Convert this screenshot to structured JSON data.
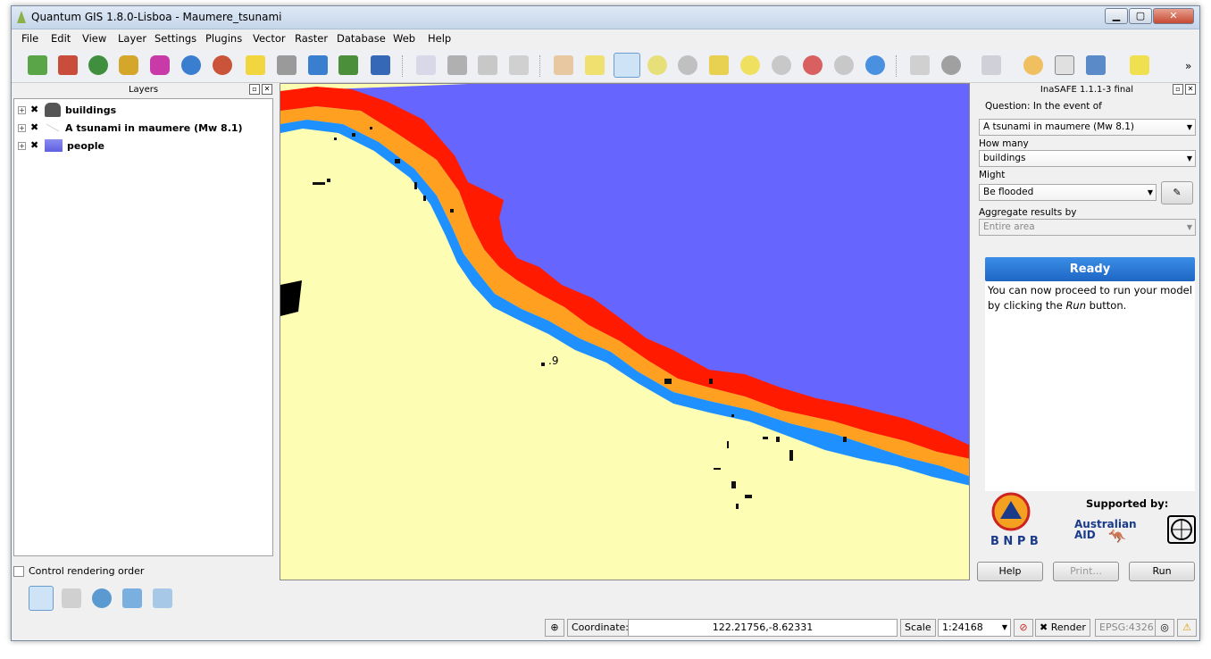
{
  "window": {
    "title": "Quantum GIS 1.8.0-Lisboa - Maumere_tsunami"
  },
  "menu": [
    "File",
    "Edit",
    "View",
    "Layer",
    "Settings",
    "Plugins",
    "Vector",
    "Raster",
    "Database",
    "Web",
    "Help"
  ],
  "layers_panel": {
    "title": "Layers",
    "items": [
      {
        "label": "buildings"
      },
      {
        "label": "A tsunami in maumere (Mw 8.1)"
      },
      {
        "label": "people"
      }
    ],
    "control_rendering_order": "Control rendering order"
  },
  "inasafe": {
    "title": "InaSAFE 1.1.1-3 final",
    "question_label": "Question: In the event of",
    "hazard_value": "A tsunami in maumere (Mw 8.1)",
    "how_many_label": "How many",
    "exposure_value": "buildings",
    "might_label": "Might",
    "function_value": "Be flooded",
    "aggregate_label": "Aggregate results by",
    "aggregate_value": "Entire area",
    "status_title": "Ready",
    "message_part1": "You can now proceed to run your model by clicking the ",
    "message_em": "Run",
    "message_part2": " button.",
    "supported_by": "Supported by:",
    "bnpb": "B N P B",
    "aid_line1": "Australian",
    "aid_line2": "AID",
    "buttons": {
      "help": "Help",
      "print": "Print...",
      "run": "Run"
    }
  },
  "map": {
    "label": ".9"
  },
  "statusbar": {
    "coordinate_label": "Coordinate:",
    "coordinate_value": "122.21756,-8.62331",
    "scale_label": "Scale",
    "scale_value": "1:24168",
    "render_label": "Render",
    "epsg": "EPSG:4326"
  },
  "colors": {
    "sea": "#6666ff",
    "land": "#fdfdb4",
    "accent": "#1f66c4"
  }
}
